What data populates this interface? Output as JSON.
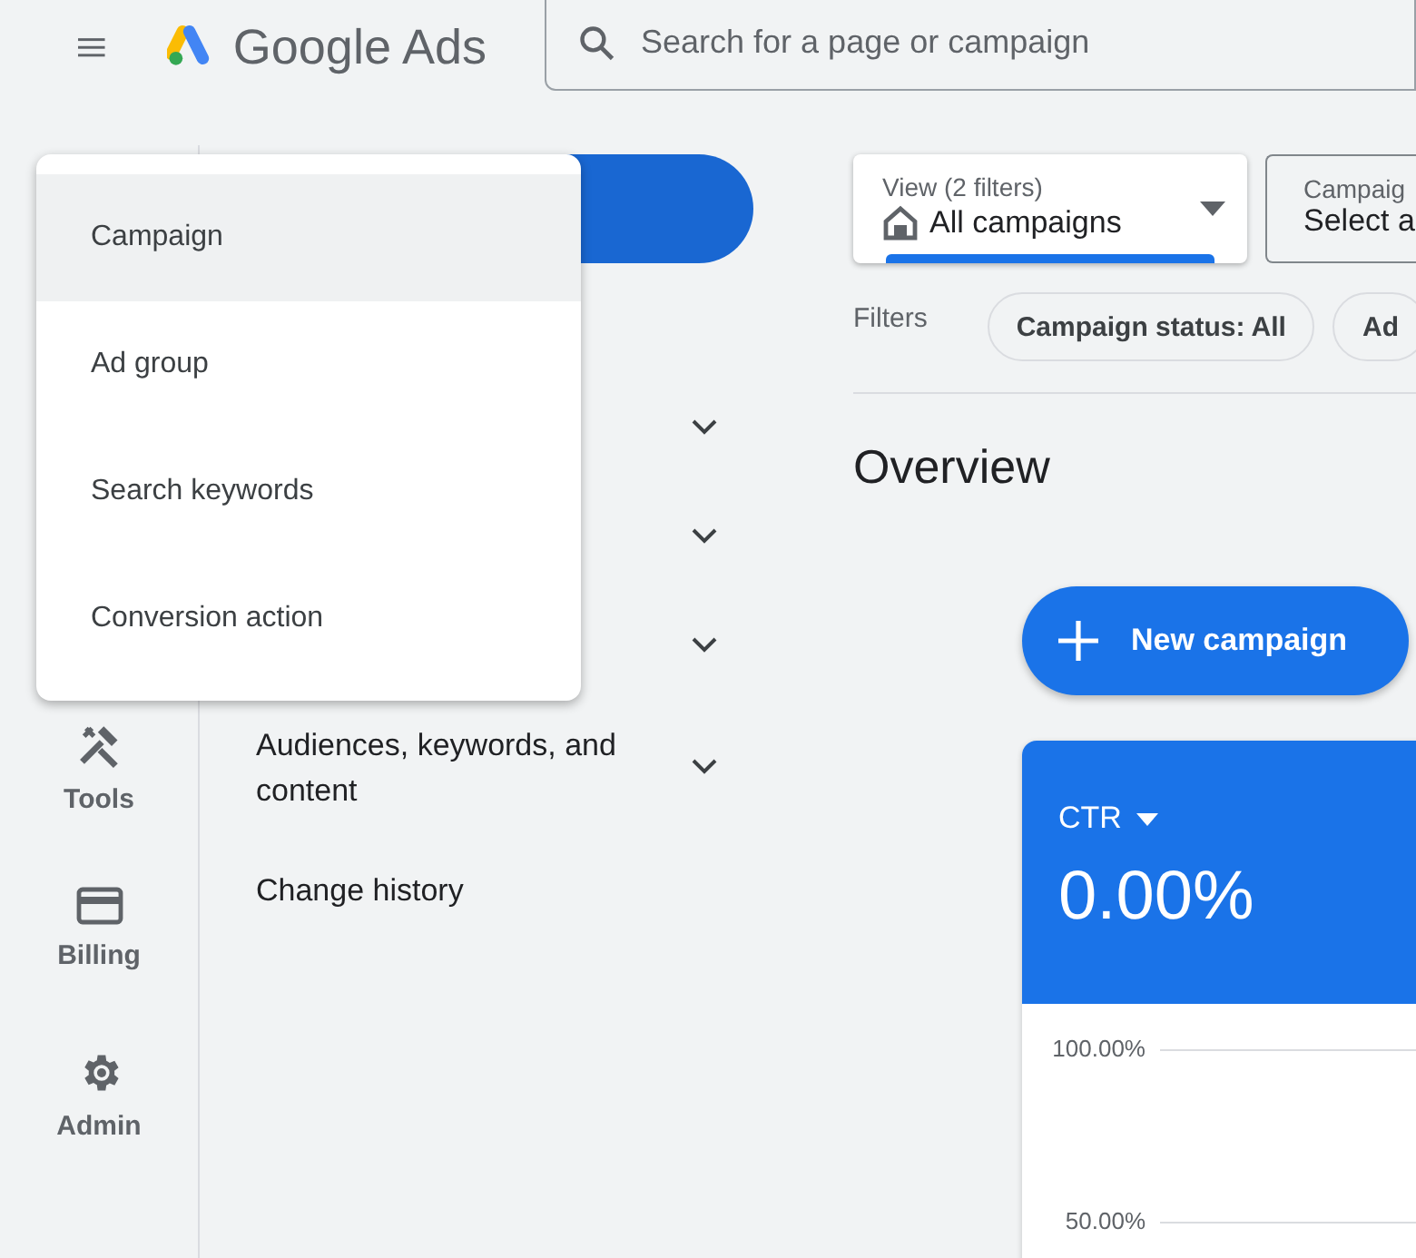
{
  "header": {
    "product_name": "Google Ads",
    "search": {
      "placeholder": "Search for a page or campaign"
    }
  },
  "rail": {
    "items": [
      {
        "label": "Tools"
      },
      {
        "label": "Billing"
      },
      {
        "label": "Admin"
      }
    ]
  },
  "nav": {
    "items": [
      {
        "expandable": true
      },
      {
        "expandable": true
      },
      {
        "expandable": true
      },
      {
        "label": "Audiences, keywords, and content",
        "expandable": true
      },
      {
        "label": "Change history",
        "expandable": false
      }
    ]
  },
  "create_menu": {
    "items": [
      {
        "label": "Campaign",
        "selected": true
      },
      {
        "label": "Ad group",
        "selected": false
      },
      {
        "label": "Search keywords",
        "selected": false
      },
      {
        "label": "Conversion action",
        "selected": false
      }
    ]
  },
  "view_selector": {
    "caption": "View (2 filters)",
    "value": "All campaigns"
  },
  "campaign_selector": {
    "caption": "Campaig",
    "value": "Select a"
  },
  "filters": {
    "label": "Filters",
    "chips": [
      "Campaign status: All",
      "Ad"
    ]
  },
  "overview": {
    "title": "Overview",
    "new_campaign_button": "New campaign"
  },
  "metric_card": {
    "metric": "CTR",
    "value": "0.00%",
    "axis_labels": [
      "100.00%",
      "50.00%"
    ]
  }
}
